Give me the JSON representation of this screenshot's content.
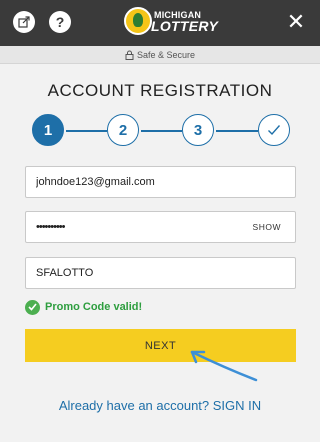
{
  "header": {
    "logo_top": "MICHIGAN",
    "logo_main": "LOTTERY",
    "help_label": "?",
    "close_label": "✕"
  },
  "secure_bar": {
    "label": "Safe & Secure"
  },
  "page": {
    "title": "ACCOUNT REGISTRATION"
  },
  "stepper": {
    "steps": [
      {
        "label": "1",
        "state": "active"
      },
      {
        "label": "2",
        "state": "upcoming"
      },
      {
        "label": "3",
        "state": "upcoming"
      },
      {
        "label": "",
        "state": "upcoming",
        "icon": "check-icon"
      }
    ],
    "accent_color": "#1e6fa8"
  },
  "form": {
    "email": {
      "value": "johndoe123@gmail.com"
    },
    "password": {
      "value": "••••••••••",
      "toggle_label": "SHOW"
    },
    "promo_code": {
      "value": "SFALOTTO"
    },
    "promo_status": "Promo Code valid!",
    "next_label": "NEXT",
    "next_color": "#f5cd20"
  },
  "footer": {
    "signin_text": "Already have an account? SIGN IN"
  }
}
